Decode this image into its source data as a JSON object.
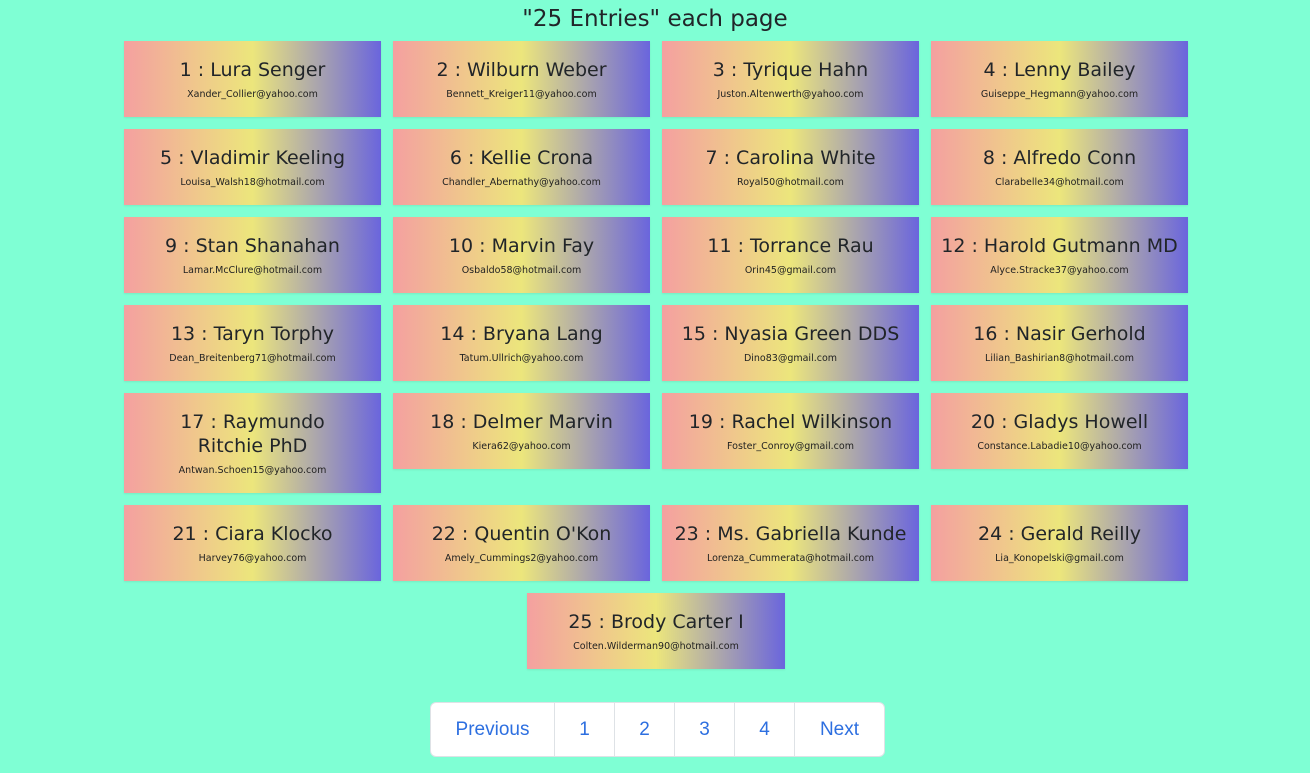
{
  "header": {
    "title": "\"25 Entries\" each page"
  },
  "cards": [
    {
      "label": "1 : Lura Senger",
      "email": "Xander_Collier@yahoo.com"
    },
    {
      "label": "2 : Wilburn Weber",
      "email": "Bennett_Kreiger11@yahoo.com"
    },
    {
      "label": "3 : Tyrique Hahn",
      "email": "Juston.Altenwerth@yahoo.com"
    },
    {
      "label": "4 : Lenny Bailey",
      "email": "Guiseppe_Hegmann@yahoo.com"
    },
    {
      "label": "5 : Vladimir Keeling",
      "email": "Louisa_Walsh18@hotmail.com"
    },
    {
      "label": "6 : Kellie Crona",
      "email": "Chandler_Abernathy@yahoo.com"
    },
    {
      "label": "7 : Carolina White",
      "email": "Royal50@hotmail.com"
    },
    {
      "label": "8 : Alfredo Conn",
      "email": "Clarabelle34@hotmail.com"
    },
    {
      "label": "9 : Stan Shanahan",
      "email": "Lamar.McClure@hotmail.com"
    },
    {
      "label": "10 : Marvin Fay",
      "email": "Osbaldo58@hotmail.com"
    },
    {
      "label": "11 : Torrance Rau",
      "email": "Orin45@gmail.com"
    },
    {
      "label": "12 : Harold Gutmann MD",
      "email": "Alyce.Stracke37@yahoo.com"
    },
    {
      "label": "13 : Taryn Torphy",
      "email": "Dean_Breitenberg71@hotmail.com"
    },
    {
      "label": "14 : Bryana Lang",
      "email": "Tatum.Ullrich@yahoo.com"
    },
    {
      "label": "15 : Nyasia Green DDS",
      "email": "Dino83@gmail.com"
    },
    {
      "label": "16 : Nasir Gerhold",
      "email": "Lilian_Bashirian8@hotmail.com"
    },
    {
      "label": "17 : Raymundo Ritchie PhD",
      "email": "Antwan.Schoen15@yahoo.com"
    },
    {
      "label": "18 : Delmer Marvin",
      "email": "Kiera62@yahoo.com"
    },
    {
      "label": "19 : Rachel Wilkinson",
      "email": "Foster_Conroy@gmail.com"
    },
    {
      "label": "20 : Gladys Howell",
      "email": "Constance.Labadie10@yahoo.com"
    },
    {
      "label": "21 : Ciara Klocko",
      "email": "Harvey76@yahoo.com"
    },
    {
      "label": "22 : Quentin O'Kon",
      "email": "Amely_Cummings2@yahoo.com"
    },
    {
      "label": "23 : Ms. Gabriella Kunde",
      "email": "Lorenza_Cummerata@hotmail.com"
    },
    {
      "label": "24 : Gerald Reilly",
      "email": "Lia_Konopelski@gmail.com"
    },
    {
      "label": "25 : Brody Carter I",
      "email": "Colten.Wilderman90@hotmail.com"
    }
  ],
  "pagination": {
    "previous": "Previous",
    "pages": [
      "1",
      "2",
      "3",
      "4"
    ],
    "next": "Next"
  },
  "colors": {
    "background": "#7fffd4",
    "gradient_start": "#f4a0a0",
    "gradient_mid": "#ece67c",
    "gradient_end": "#6a65dd",
    "link": "#2d6fe0"
  }
}
